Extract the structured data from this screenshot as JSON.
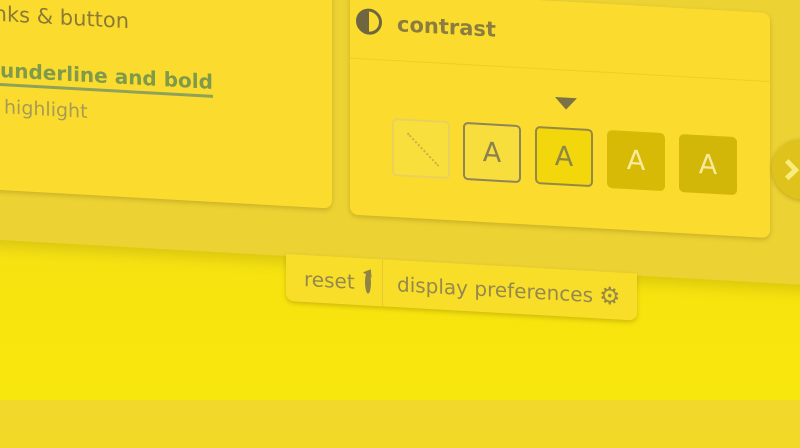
{
  "left_panel": {
    "heading": "links & button",
    "link_sample": "underline and bold",
    "highlight_sample": "highlight"
  },
  "contrast_panel": {
    "title": "contrast",
    "options": [
      {
        "label": "",
        "name": "default"
      },
      {
        "label": "A",
        "name": "dark-on-light"
      },
      {
        "label": "A",
        "name": "dark-on-yellow"
      },
      {
        "label": "A",
        "name": "light-on-gold"
      },
      {
        "label": "A",
        "name": "light-on-olive"
      }
    ],
    "selected_index": 2
  },
  "toolbar": {
    "reset_label": "reset",
    "display_preferences_label": "display preferences"
  },
  "icons": {
    "contrast": "contrast-icon",
    "reset": "reset-icon",
    "settings": "gear-icon",
    "next": "chevron-right-icon"
  },
  "colors": {
    "background": "#f5dd21",
    "panel": "#fbdc2e",
    "link": "#7e9a4a"
  }
}
